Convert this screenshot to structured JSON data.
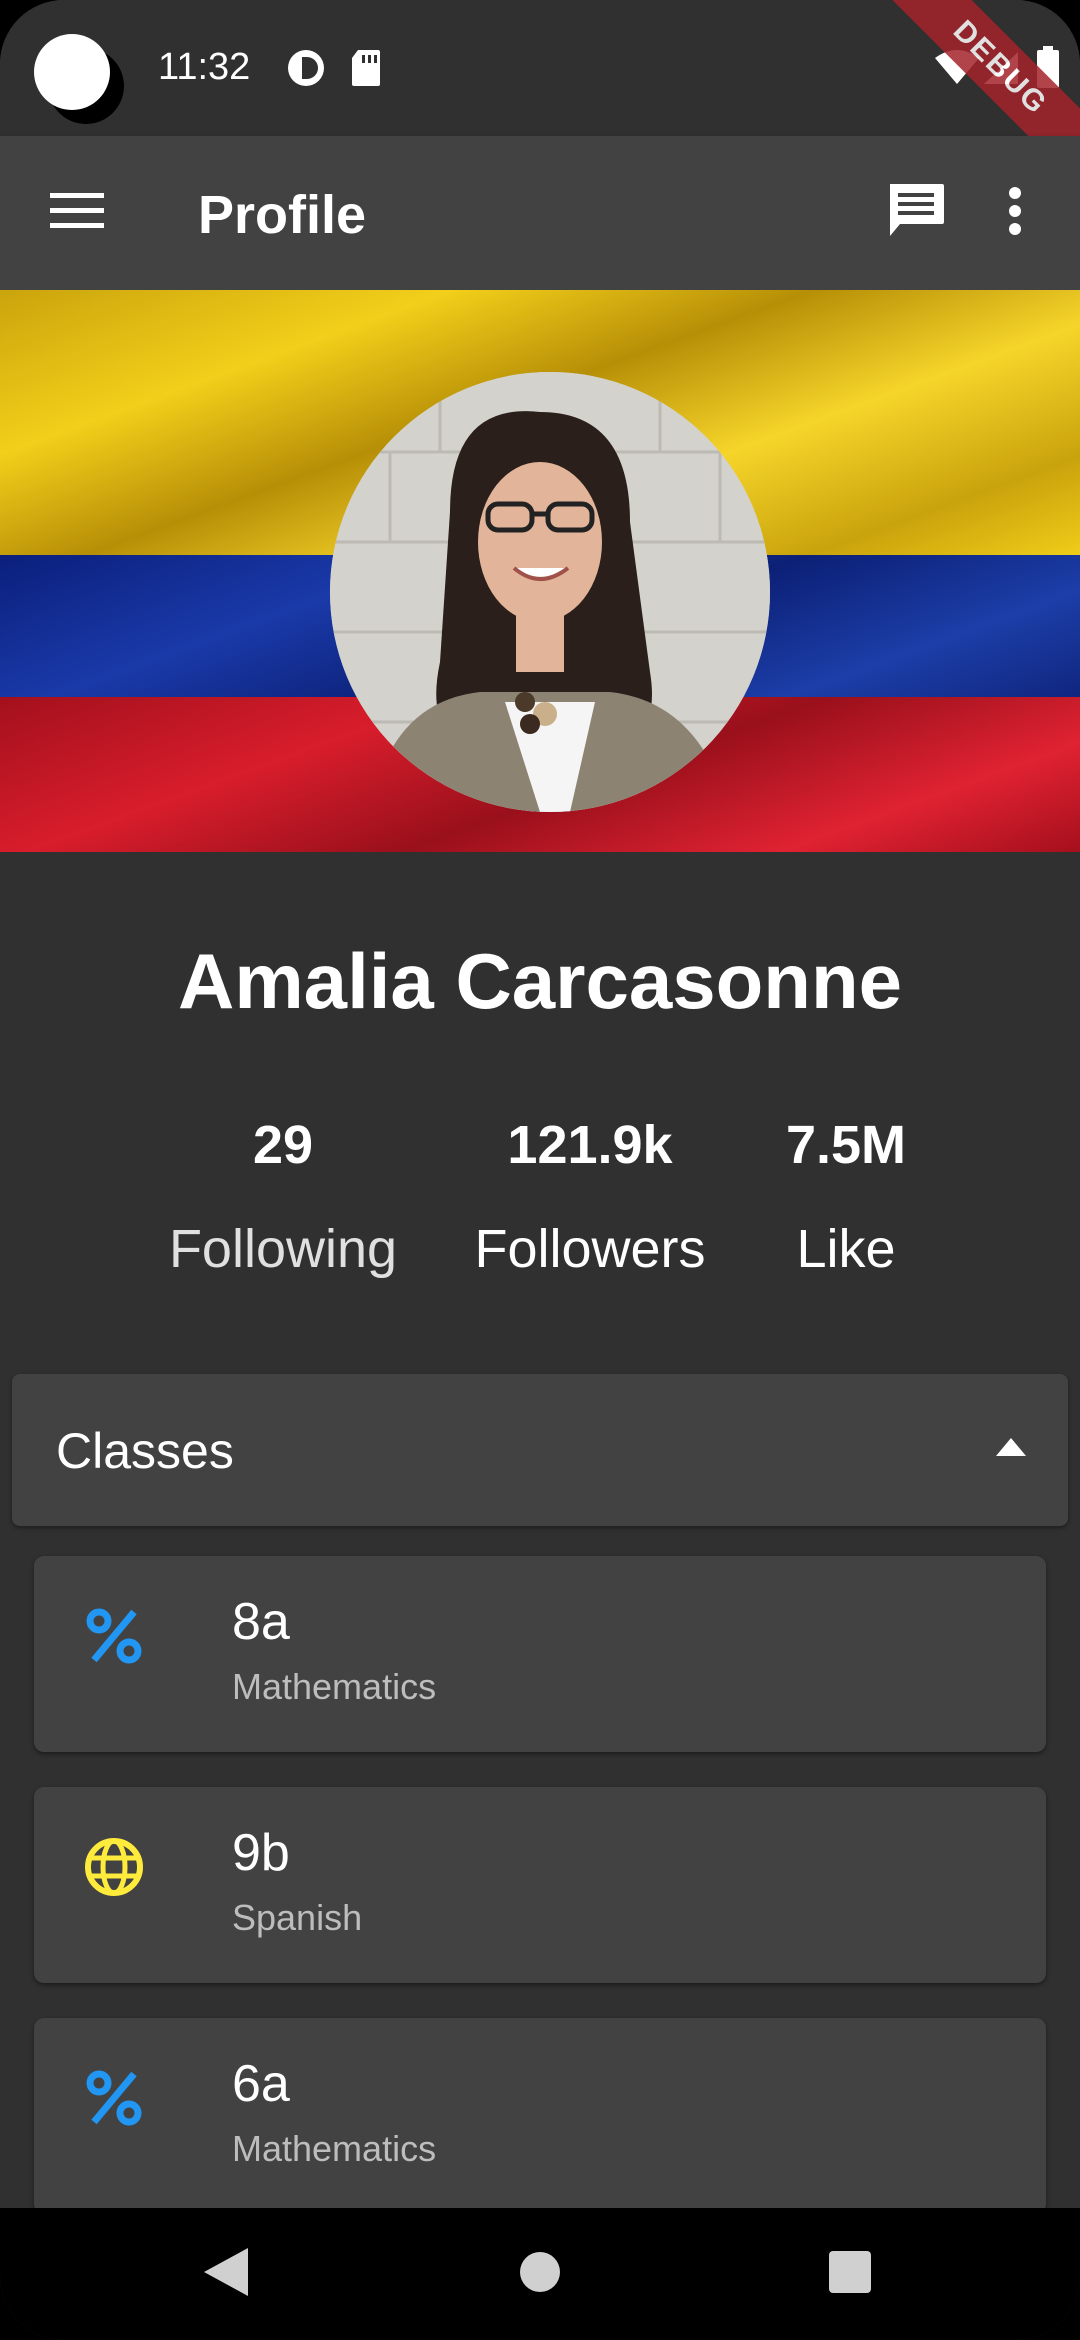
{
  "status_bar": {
    "time": "11:32",
    "debug_banner": "DEBUG"
  },
  "app_bar": {
    "title": "Profile",
    "menu_icon": "menu-icon",
    "chat_icon": "chat-icon",
    "more_icon": "more-vert-icon"
  },
  "profile": {
    "name": "Amalia Carcasonne",
    "stats": [
      {
        "value": "29",
        "label": "Following"
      },
      {
        "value": "121.9k",
        "label": "Followers"
      },
      {
        "value": "7.5M",
        "label": "Like"
      }
    ]
  },
  "classes": {
    "title": "Classes",
    "expanded": true,
    "items": [
      {
        "title": "8a",
        "subject": "Mathematics",
        "icon": "percent-icon",
        "icon_color": "#2196F3"
      },
      {
        "title": "9b",
        "subject": "Spanish",
        "icon": "globe-icon",
        "icon_color": "#FFEB3B"
      },
      {
        "title": "6a",
        "subject": "Mathematics",
        "icon": "percent-icon",
        "icon_color": "#2196F3"
      }
    ]
  },
  "colors": {
    "background": "#303030",
    "app_bar": "#424242",
    "card": "#424242"
  }
}
